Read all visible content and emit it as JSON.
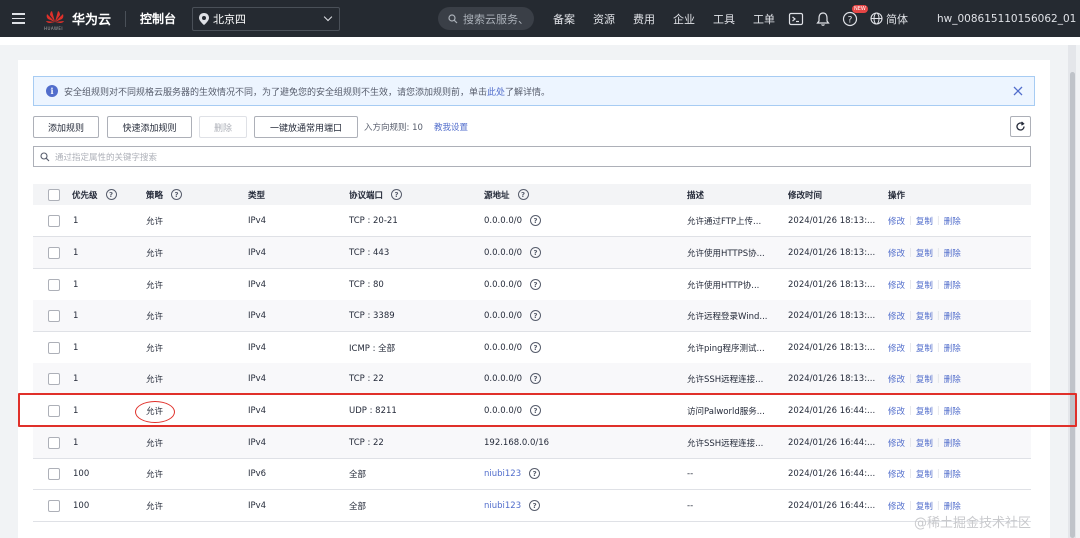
{
  "topbar": {
    "brand": "华为云",
    "brand_sub": "HUAWEI",
    "console": "控制台",
    "region": "北京四",
    "search_placeholder": "搜索云服务、",
    "nav": [
      "备案",
      "资源",
      "费用",
      "企业",
      "工具",
      "工单"
    ],
    "new_badge": "NEW",
    "lang": "简体",
    "user": "hw_008615110156062_01"
  },
  "alert": {
    "text": "安全组规则对不同规格云服务器的生效情况不同，为了避免您的安全组规则不生效，请您添加规则前，单击",
    "link": "此处",
    "tail": "了解详情。"
  },
  "toolbar": {
    "add_rule": "添加规则",
    "quick_add": "快速添加规则",
    "delete": "删除",
    "open_common": "一键放通常用端口",
    "inbound_count": "入方向规则: 10",
    "tutorial": "教我设置"
  },
  "filter": {
    "placeholder": "通过指定属性的关键字搜索"
  },
  "table": {
    "headers": {
      "priority": "优先级",
      "policy": "策略",
      "type": "类型",
      "port": "协议端口",
      "source": "源地址",
      "desc": "描述",
      "modified": "修改时间",
      "ops": "操作"
    },
    "actions": {
      "edit": "修改",
      "copy": "复制",
      "delete": "删除"
    },
    "rows": [
      {
        "priority": "1",
        "policy": "允许",
        "type": "IPv4",
        "port": "TCP : 20-21",
        "source": "0.0.0.0/0",
        "desc": "允许通过FTP上传...",
        "modified": "2024/01/26 18:13:..."
      },
      {
        "priority": "1",
        "policy": "允许",
        "type": "IPv4",
        "port": "TCP : 443",
        "source": "0.0.0.0/0",
        "desc": "允许使用HTTPS协...",
        "modified": "2024/01/26 18:13:..."
      },
      {
        "priority": "1",
        "policy": "允许",
        "type": "IPv4",
        "port": "TCP : 80",
        "source": "0.0.0.0/0",
        "desc": "允许使用HTTP协...",
        "modified": "2024/01/26 18:13:..."
      },
      {
        "priority": "1",
        "policy": "允许",
        "type": "IPv4",
        "port": "TCP : 3389",
        "source": "0.0.0.0/0",
        "desc": "允许远程登录Wind...",
        "modified": "2024/01/26 18:13:..."
      },
      {
        "priority": "1",
        "policy": "允许",
        "type": "IPv4",
        "port": "ICMP : 全部",
        "source": "0.0.0.0/0",
        "desc": "允许ping程序测试...",
        "modified": "2024/01/26 18:13:..."
      },
      {
        "priority": "1",
        "policy": "允许",
        "type": "IPv4",
        "port": "TCP : 22",
        "source": "0.0.0.0/0",
        "desc": "允许SSH远程连接...",
        "modified": "2024/01/26 18:13:..."
      },
      {
        "priority": "1",
        "policy": "允许",
        "type": "IPv4",
        "port": "UDP : 8211",
        "source": "0.0.0.0/0",
        "desc": "访问Palworld服务...",
        "modified": "2024/01/26 16:44:..."
      },
      {
        "priority": "1",
        "policy": "允许",
        "type": "IPv4",
        "port": "TCP : 22",
        "source": "192.168.0.0/16",
        "desc": "允许SSH远程连接...",
        "modified": "2024/01/26 16:44:..."
      },
      {
        "priority": "100",
        "policy": "允许",
        "type": "IPv6",
        "port": "全部",
        "source": "niubi123",
        "desc": "--",
        "modified": "2024/01/26 16:44:..."
      },
      {
        "priority": "100",
        "policy": "允许",
        "type": "IPv4",
        "port": "全部",
        "source": "niubi123",
        "desc": "--",
        "modified": "2024/01/26 16:44:..."
      }
    ]
  },
  "watermark": "@稀土掘金技术社区",
  "colors": {
    "topbar": "#252a31",
    "link": "#526ecc",
    "highlight": "#e0302a"
  }
}
